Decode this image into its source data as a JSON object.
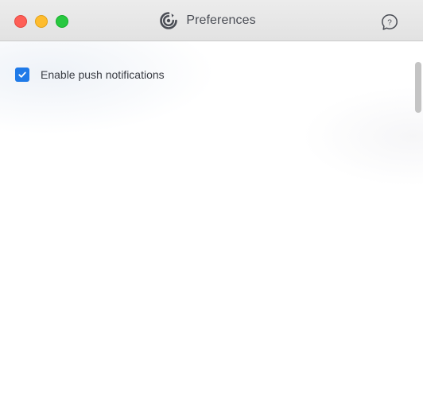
{
  "window": {
    "title": "Preferences",
    "app_icon": "app-logo-icon",
    "help_icon": "help-question-icon"
  },
  "settings": {
    "push_notifications": {
      "label": "Enable push notifications",
      "checked": true
    }
  },
  "colors": {
    "accent": "#1f7ae8",
    "close": "#fe5f57",
    "minimize": "#febc2e",
    "zoom": "#28c840"
  }
}
